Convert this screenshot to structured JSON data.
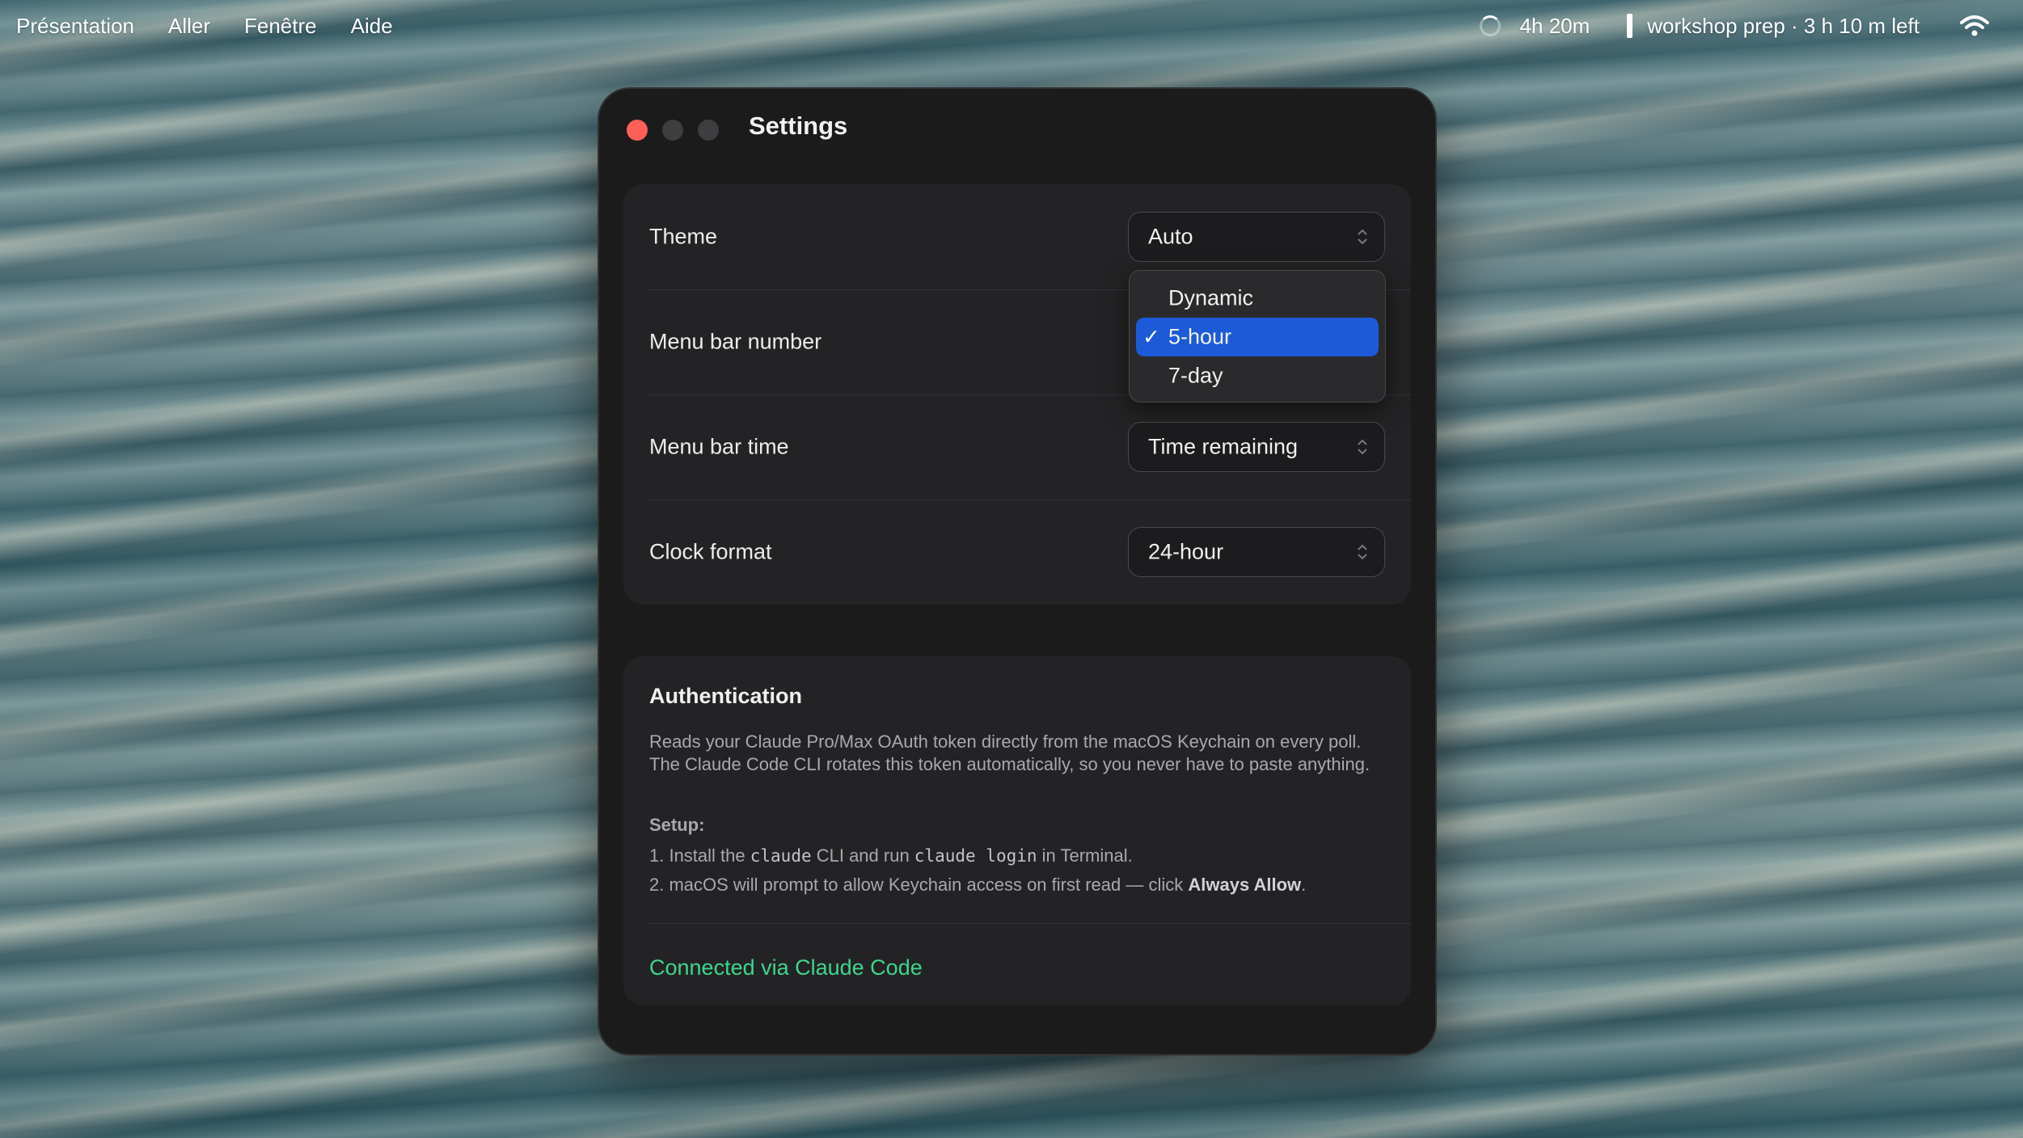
{
  "menubar": {
    "items": [
      "Présentation",
      "Aller",
      "Fenêtre",
      "Aide"
    ],
    "timer": "4h 20m",
    "event": "workshop prep · 3 h 10 m left",
    "icons": [
      "spinner-icon",
      "event-bar-icon",
      "wifi-icon"
    ]
  },
  "window": {
    "title": "Settings",
    "controls": [
      "close-icon",
      "minimize-icon",
      "zoom-icon"
    ]
  },
  "settings": {
    "theme": {
      "label": "Theme",
      "value": "Auto"
    },
    "menu_bar_number": {
      "label": "Menu bar number",
      "value": "5-hour",
      "options": [
        "Dynamic",
        "5-hour",
        "7-day"
      ],
      "check": "✓"
    },
    "menu_bar_time": {
      "label": "Menu bar time",
      "value": "Time remaining"
    },
    "clock_format": {
      "label": "Clock format",
      "value": "24-hour"
    }
  },
  "auth": {
    "title": "Authentication",
    "description": "Reads your Claude Pro/Max OAuth token directly from the macOS Keychain on every poll. The Claude Code CLI rotates this token automatically, so you never have to paste anything.",
    "setup_label": "Setup:",
    "step1": {
      "prefix": "1. Install the ",
      "code1": "claude",
      "middle": " CLI and run ",
      "code2": "claude login",
      "suffix": " in Terminal."
    },
    "step2": {
      "prefix": "2. macOS will prompt to allow Keychain access on first read — click ",
      "strong": "Always Allow",
      "suffix": "."
    },
    "status": "Connected via Claude Code"
  },
  "colors": {
    "accent_selected": "#1d5ad8",
    "status_green": "#3dd68c",
    "close_red": "#fe5f57"
  }
}
